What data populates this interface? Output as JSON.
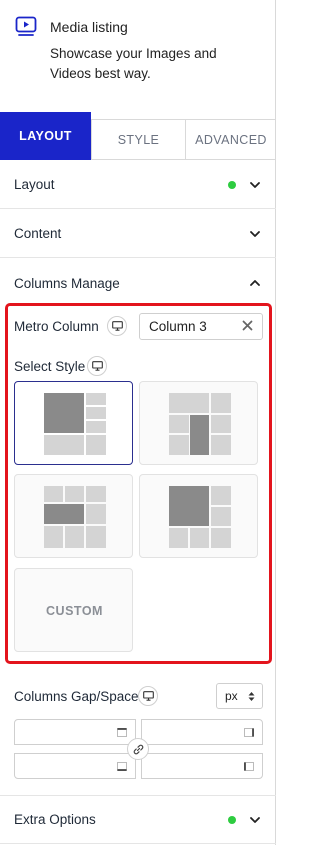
{
  "header": {
    "title": "Media listing",
    "description": "Showcase your Images and Videos best way.",
    "icon": "media-player-icon"
  },
  "tabs": [
    {
      "label": "LAYOUT",
      "active": true
    },
    {
      "label": "STYLE",
      "active": false
    },
    {
      "label": "ADVANCED",
      "active": false
    }
  ],
  "sections": {
    "layout": {
      "label": "Layout",
      "has_indicator": true
    },
    "content": {
      "label": "Content"
    },
    "columns_manage": {
      "label": "Columns Manage",
      "expanded": true
    },
    "extra_options": {
      "label": "Extra Options",
      "has_indicator": true
    }
  },
  "columns_manage": {
    "metro_column_label": "Metro Column",
    "metro_column_value": "Column 3",
    "select_style_label": "Select Style",
    "styles": [
      {
        "id": "style-1",
        "selected": true
      },
      {
        "id": "style-2",
        "selected": false
      },
      {
        "id": "style-3",
        "selected": false
      },
      {
        "id": "style-4",
        "selected": false
      },
      {
        "id": "custom",
        "label": "CUSTOM",
        "selected": false
      }
    ],
    "gap_label": "Columns Gap/Space",
    "gap_unit": "px",
    "gap_values": {
      "top": "",
      "right": "",
      "bottom": "",
      "left": ""
    }
  },
  "colors": {
    "accent": "#1a25c9",
    "highlight_frame": "#e3141d",
    "indicator": "#2ecc40",
    "selected_card_border": "#2b2f8f"
  }
}
